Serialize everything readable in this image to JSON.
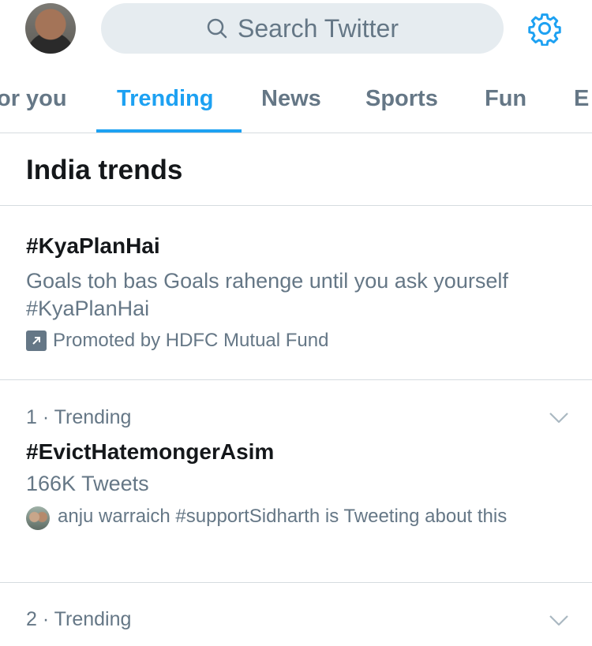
{
  "header": {
    "search_placeholder": "Search Twitter",
    "icons": {
      "search": "search-icon",
      "settings": "gear-icon"
    },
    "accent_color": "#1da1f2"
  },
  "tabs": [
    {
      "label": "For you",
      "visible_text": "or you",
      "active": false
    },
    {
      "label": "Trending",
      "active": true
    },
    {
      "label": "News",
      "active": false
    },
    {
      "label": "Sports",
      "active": false
    },
    {
      "label": "Fun",
      "active": false
    },
    {
      "label": "Entertainment",
      "visible_text": "E",
      "active": false
    }
  ],
  "section": {
    "title": "India trends"
  },
  "promoted": {
    "hashtag": "#KyaPlanHai",
    "description": "Goals toh bas Goals rahenge until you ask yourself #KyaPlanHai",
    "promoted_by": "Promoted by HDFC Mutual Fund"
  },
  "trends": [
    {
      "meta": "1 · Trending",
      "name": "#EvictHatemongerAsim",
      "tweet_count": "166K Tweets",
      "context": "anju warraich #supportSidharth is Tweeting about this"
    },
    {
      "meta": "2 · Trending"
    }
  ]
}
